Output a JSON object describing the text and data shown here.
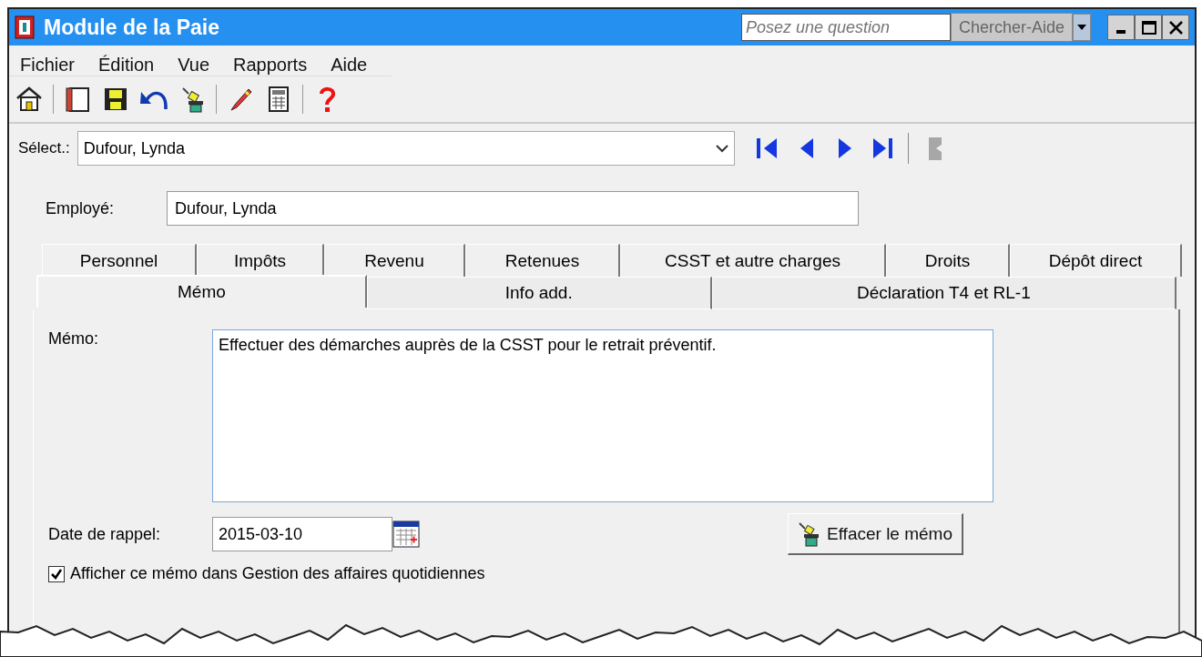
{
  "window": {
    "title": "Module de la Paie"
  },
  "help_search": {
    "placeholder": "Posez une question",
    "button": "Chercher-Aide"
  },
  "menu": [
    "Fichier",
    "Édition",
    "Vue",
    "Rapports",
    "Aide"
  ],
  "toolbar": [
    {
      "kind": "home"
    },
    {
      "kind": "separator"
    },
    {
      "kind": "notebook"
    },
    {
      "kind": "save"
    },
    {
      "kind": "undo"
    },
    {
      "kind": "erase"
    },
    {
      "kind": "separator"
    },
    {
      "kind": "pen"
    },
    {
      "kind": "calculator"
    },
    {
      "kind": "separator"
    },
    {
      "kind": "help"
    }
  ],
  "select": {
    "label": "Sélect.:",
    "value": "Dufour, Lynda"
  },
  "navigation": [
    {
      "kind": "first",
      "disabled": false
    },
    {
      "kind": "prev",
      "disabled": false
    },
    {
      "kind": "next",
      "disabled": false
    },
    {
      "kind": "last",
      "disabled": false
    },
    {
      "kind": "separator"
    },
    {
      "kind": "bookmark",
      "disabled": true
    }
  ],
  "employee": {
    "label": "Employé:",
    "value": "Dufour, Lynda"
  },
  "tabs_back": [
    {
      "label": "Personnel",
      "selected": false
    },
    {
      "label": "Impôts",
      "selected": false
    },
    {
      "label": "Revenu",
      "selected": false
    },
    {
      "label": "Retenues",
      "selected": false
    },
    {
      "label": "CSST et autre charges",
      "selected": false
    },
    {
      "label": "Droits",
      "selected": false
    },
    {
      "label": "Dépôt direct",
      "selected": false
    }
  ],
  "tabs_front": [
    {
      "label": "Mémo",
      "selected": true
    },
    {
      "label": "Info add.",
      "selected": false
    },
    {
      "label": "Déclaration T4 et RL-1",
      "selected": false
    }
  ],
  "memo": {
    "label": "Mémo:",
    "value": "Effectuer des démarches auprès de la CSST pour le retrait préventif."
  },
  "reminder": {
    "label": "Date de rappel:",
    "value": "2015-03-10"
  },
  "clear_button": "Effacer le mémo",
  "show_checkbox": {
    "label": "Afficher ce mémo dans Gestion des affaires quotidiennes",
    "checked": true
  }
}
